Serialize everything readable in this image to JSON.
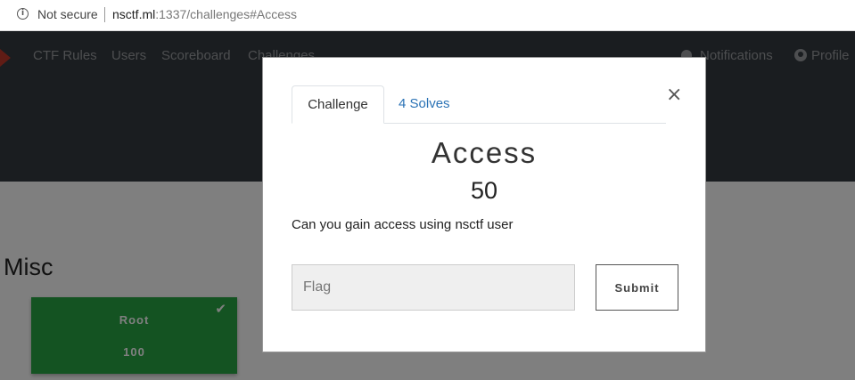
{
  "browser": {
    "security_label": "Not secure",
    "url_host": "nsctf.ml",
    "url_rest": ":1337/challenges#Access"
  },
  "nav": {
    "items": [
      "CTF Rules",
      "Users",
      "Scoreboard",
      "Challenges"
    ],
    "notifications": "Notifications",
    "profile": "Profile"
  },
  "page": {
    "category": "Misc",
    "challenges": [
      {
        "name": "Root",
        "value": "100",
        "solved": true
      }
    ]
  },
  "modal": {
    "tabs": [
      "Challenge",
      "4 Solves"
    ],
    "close": "×",
    "title": "Access",
    "value": "50",
    "description": "Can you gain access using nsctf user",
    "flag_placeholder": "Flag",
    "submit_label": "Submit"
  },
  "colors": {
    "navbar": "#343a40",
    "solved_card": "#28a745",
    "tab_link": "#2a72b5"
  }
}
